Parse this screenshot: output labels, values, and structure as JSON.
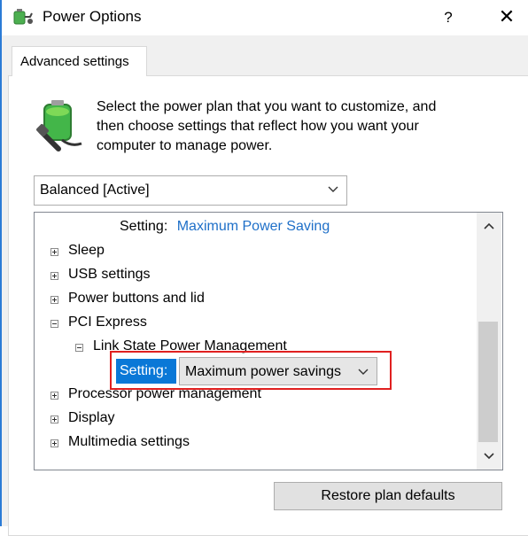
{
  "window": {
    "title": "Power Options",
    "help_glyph": "?",
    "close_glyph": "✕"
  },
  "tab": {
    "label": "Advanced settings"
  },
  "intro": {
    "line1": "Select the power plan that you want to customize, and",
    "line2": "then choose settings that reflect how you want your",
    "line3": "computer to manage power."
  },
  "plan_select": {
    "value": "Balanced [Active]"
  },
  "tree": {
    "top_setting_label": "Setting:",
    "top_setting_value": "Maximum Power Saving",
    "items": [
      {
        "label": "Sleep",
        "expanded": false
      },
      {
        "label": "USB settings",
        "expanded": false
      },
      {
        "label": "Power buttons and lid",
        "expanded": false
      },
      {
        "label": "PCI Express",
        "expanded": true
      },
      {
        "label": "Link State Power Management",
        "expanded": true
      },
      {
        "label": "Processor power management",
        "expanded": false
      },
      {
        "label": "Display",
        "expanded": false
      },
      {
        "label": "Multimedia settings",
        "expanded": false
      }
    ],
    "selected_setting_label": "Setting:",
    "selected_setting_value": "Maximum power savings"
  },
  "buttons": {
    "restore": "Restore plan defaults"
  },
  "colors": {
    "accent": "#0a78d7",
    "highlight_border": "#e02020",
    "link_blue": "#1e6fc8"
  }
}
